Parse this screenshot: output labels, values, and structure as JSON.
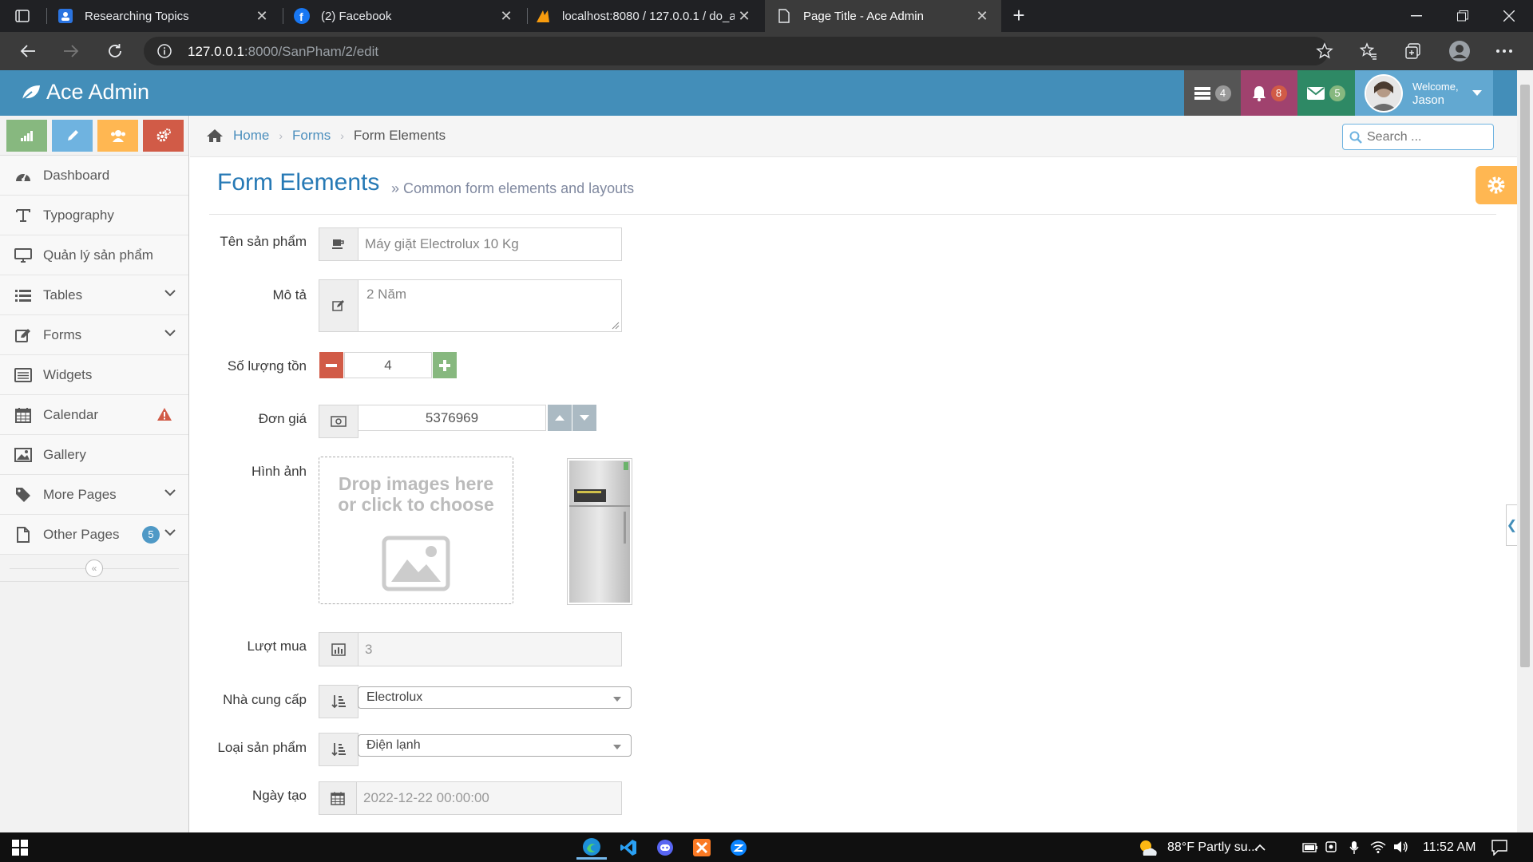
{
  "browser": {
    "tabs": [
      {
        "title": "Researching Topics",
        "active": false
      },
      {
        "title": "(2) Facebook",
        "active": false
      },
      {
        "title": "localhost:8080 / 127.0.0.1 / do_a",
        "active": false
      },
      {
        "title": "Page Title - Ace Admin",
        "active": true
      }
    ],
    "url_host": "127.0.0.1",
    "url_path": ":8000/SanPham/2/edit"
  },
  "navbar": {
    "brand": "Ace Admin",
    "tasks_count": "4",
    "notifications_count": "8",
    "messages_count": "5",
    "welcome": "Welcome,",
    "user": "Jason"
  },
  "sidebar": {
    "items": [
      {
        "label": "Dashboard",
        "icon": "tachometer-icon"
      },
      {
        "label": "Typography",
        "icon": "text-icon"
      },
      {
        "label": "Quản lý sản phẩm",
        "icon": "desktop-icon"
      },
      {
        "label": "Tables",
        "icon": "list-icon",
        "chevron": true
      },
      {
        "label": "Forms",
        "icon": "pencil-square-icon",
        "chevron": true
      },
      {
        "label": "Widgets",
        "icon": "list-alt-icon"
      },
      {
        "label": "Calendar",
        "icon": "calendar-icon",
        "warning": true
      },
      {
        "label": "Gallery",
        "icon": "picture-icon"
      },
      {
        "label": "More Pages",
        "icon": "tag-icon",
        "chevron": true
      },
      {
        "label": "Other Pages",
        "icon": "file-icon",
        "badge": "5",
        "chevron": true
      }
    ]
  },
  "breadcrumb": {
    "home": "Home",
    "forms": "Forms",
    "current": "Form Elements"
  },
  "search": {
    "placeholder": "Search ..."
  },
  "page": {
    "title": "Form Elements",
    "subtitle": "» Common form elements and layouts"
  },
  "form": {
    "name_label": "Tên sản phẩm",
    "name_value": "Máy giặt Electrolux 10 Kg",
    "desc_label": "Mô tả",
    "desc_value": "2 Năm",
    "stock_label": "Số lượng tồn",
    "stock_value": "4",
    "price_label": "Đơn giá",
    "price_value": "5376969",
    "image_label": "Hình ảnh",
    "dropzone_text": "Drop images here or click to choose",
    "purchases_label": "Lượt mua",
    "purchases_value": "3",
    "supplier_label": "Nhà cung cấp",
    "supplier_value": "Electrolux",
    "category_label": "Loại sản phẩm",
    "category_value": "Điện lạnh",
    "created_label": "Ngày tạo",
    "created_value": "2022-12-22 00:00:00"
  },
  "taskbar": {
    "weather": "88°F  Partly su...",
    "time": "11:52 AM"
  },
  "colors": {
    "navbar": "#438eb9",
    "title": "#2679b5",
    "green": "#87b87f",
    "blue": "#6fb3e0",
    "orange": "#ffb752",
    "red": "#d15b47"
  }
}
